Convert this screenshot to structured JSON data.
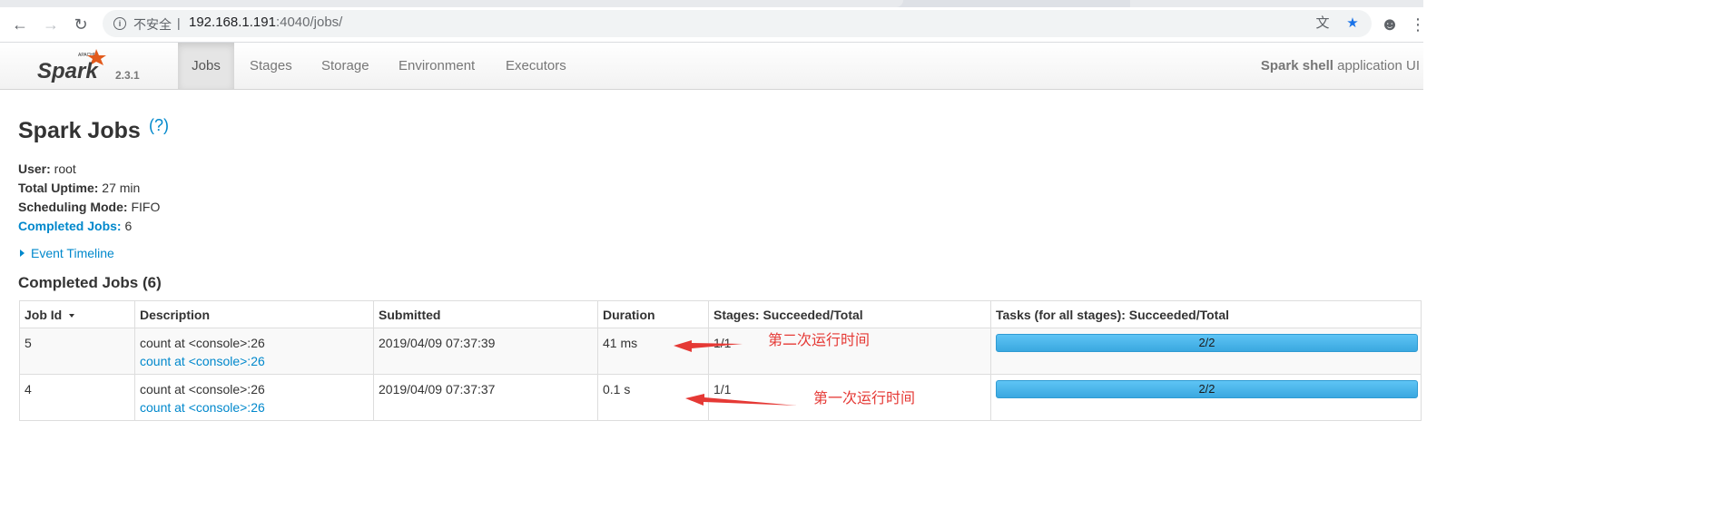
{
  "browser": {
    "security_label": "不安全",
    "url_host": "192.168.1.191",
    "url_path": ":4040/jobs/"
  },
  "navbar": {
    "brand": "Spark",
    "brand_small": "APACHE",
    "version": "2.3.1",
    "tabs": [
      {
        "label": "Jobs",
        "active": true
      },
      {
        "label": "Stages"
      },
      {
        "label": "Storage"
      },
      {
        "label": "Environment"
      },
      {
        "label": "Executors"
      }
    ],
    "app_name_bold": "Spark shell",
    "app_name_rest": " application UI"
  },
  "page": {
    "title": "Spark Jobs",
    "help": "(?)",
    "summary": {
      "user_label": "User:",
      "user": " root",
      "uptime_label": "Total Uptime:",
      "uptime": " 27 min",
      "mode_label": "Scheduling Mode:",
      "mode": " FIFO",
      "completed_label": "Completed Jobs:",
      "completed": " 6"
    },
    "event_timeline": "Event Timeline",
    "section_title": "Completed Jobs (6)"
  },
  "table": {
    "headers": [
      "Job Id",
      "Description",
      "Submitted",
      "Duration",
      "Stages: Succeeded/Total",
      "Tasks (for all stages): Succeeded/Total"
    ],
    "rows": [
      {
        "job_id": "5",
        "desc": "count at <console>:26",
        "desc_link": "count at <console>:26",
        "submitted": "2019/04/09 07:37:39",
        "duration": "41 ms",
        "stages": "1/1",
        "tasks": "2/2",
        "tasks_fraction": 1.0
      },
      {
        "job_id": "4",
        "desc": "count at <console>:26",
        "desc_link": "count at <console>:26",
        "submitted": "2019/04/09 07:37:37",
        "duration": "0.1 s",
        "stages": "1/1",
        "tasks": "2/2",
        "tasks_fraction": 1.0
      }
    ]
  },
  "annotations": {
    "second_run": "第二次运行时间",
    "first_run": "第一次运行时间",
    "color": "#e53935"
  },
  "colors": {
    "link": "#0088cc",
    "progress": "#49b7ee"
  }
}
